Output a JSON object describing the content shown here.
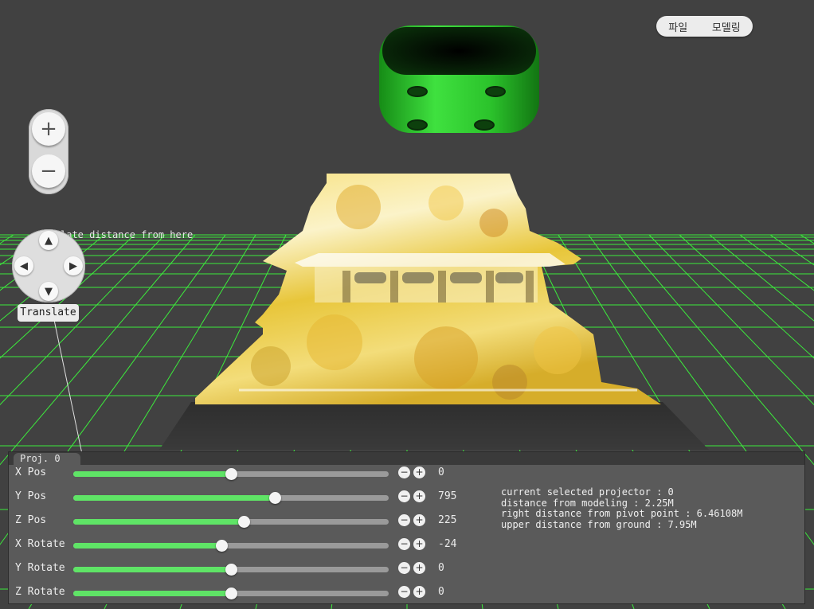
{
  "menu": {
    "file_label": "파일",
    "modeling_label": "모델링"
  },
  "zoom": {
    "in_label": "+",
    "out_label": "−"
  },
  "translate": {
    "label": "Translate",
    "hint": "late distance from here",
    "up": "▲",
    "down": "▼",
    "left": "◀",
    "right": "▶"
  },
  "panel": {
    "tab_label": "Proj. 0",
    "rows": [
      {
        "label": "X Pos",
        "value": "0",
        "slider_fraction": 0.5
      },
      {
        "label": "Y Pos",
        "value": "795",
        "slider_fraction": 0.64
      },
      {
        "label": "Z Pos",
        "value": "225",
        "slider_fraction": 0.54
      },
      {
        "label": "X Rotate",
        "value": "-24",
        "slider_fraction": 0.47
      },
      {
        "label": "Y Rotate",
        "value": "0",
        "slider_fraction": 0.5
      },
      {
        "label": "Z Rotate",
        "value": "0",
        "slider_fraction": 0.5
      }
    ],
    "minus_label": "−",
    "plus_label": "+",
    "info": [
      "current selected projector : 0",
      "distance from modeling : 2.25M",
      "right distance from pivot point : 6.46108M",
      "upper distance from ground : 7.95M"
    ]
  },
  "colors": {
    "background": "#414141",
    "grid": "#3cff3c",
    "projector": "#2fd12f",
    "slider_fill": "#5fe466",
    "panel": "#5a5a5a"
  },
  "scene": {
    "subject": "projected-pavilion-image",
    "icon": "projector-device"
  }
}
